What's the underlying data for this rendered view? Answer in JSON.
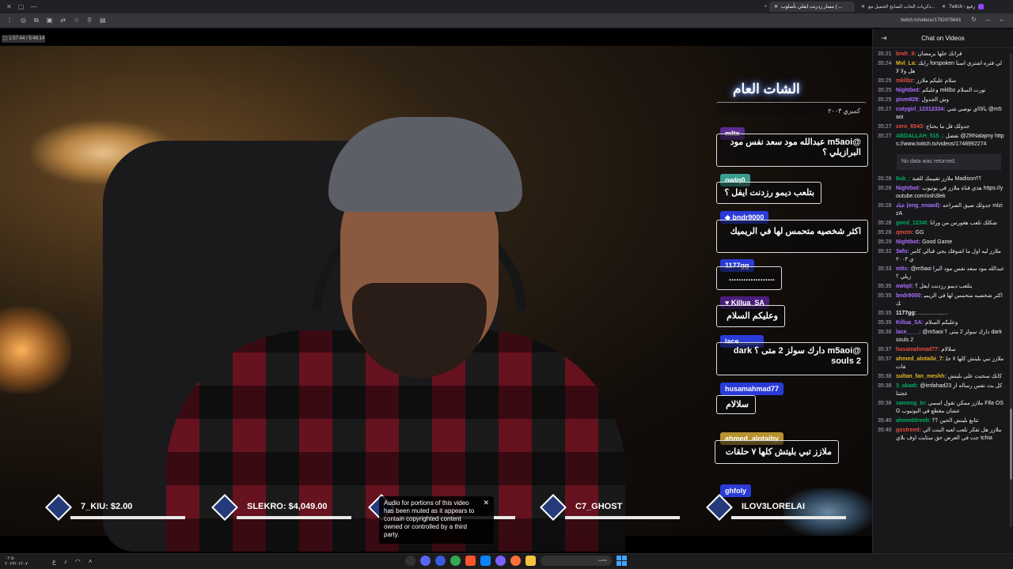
{
  "browser": {
    "tabs": [
      {
        "label": "Twitch - رفيع",
        "active": false
      },
      {
        "label": "ذكريات الحاب السابح الجميل مع..."
      },
      {
        "label": "مسار ردزنت ايفلي بأسلوب ( ... ",
        "active": true
      }
    ],
    "new_tab": "+",
    "url": "twitch.tv/videos/1792475643"
  },
  "video": {
    "tag": "▢ 1:57:44 / 5:46:14",
    "overlay_title": "الشات العام",
    "overlay_messages": [
      {
        "name": "",
        "text": "كمبري ٢٠٠٣",
        "name_color": "#000000"
      },
      {
        "name": "mltx",
        "text": "@m5aoi عبدالله مود سعد نفس مود البرازيلي ؟",
        "name_color": "#5b2d91"
      },
      {
        "name": "owlq0",
        "text": "بتلعب ديمو رزدنت ايفل ؟",
        "name_color": "#3a9e8f"
      },
      {
        "name": "bndr9000",
        "text": "اكثر شخصيه متحمس لها في الريميك",
        "name_color": "#2a3bd8"
      },
      {
        "name": "1177gg",
        "text": "...................",
        "name_color": "#2a3bd8"
      },
      {
        "name": "Killua_SA",
        "text": "وعليكم السلام",
        "name_color": "#4a1e7a"
      },
      {
        "name": "lace_____",
        "text": "@m5aoi دارك سولز 2 متى ؟ dark souls 2",
        "name_color": "#2a3bd8"
      },
      {
        "name": "husamahmad77",
        "text": "سلالام",
        "name_color": "#2a3bd8"
      },
      {
        "name": "ahmed_alotaiby",
        "text": "ملازز تبي بليتش كلها ٧ حلقات",
        "name_color": "#b8922f"
      },
      {
        "name": "ghfoly",
        "text": "",
        "name_color": "#2a3bd8"
      }
    ],
    "scores": [
      {
        "label": "7_KIU: $2.00"
      },
      {
        "label": "SLEKRO: $4,049.00"
      },
      {
        "label": ""
      },
      {
        "label": "C7_GHOST"
      },
      {
        "label": "ILOV3LORELAI"
      }
    ],
    "notice": "Audio for portions of this video has been muted as it appears to contain copyrighted content owned or controlled by a third party.",
    "notice_close": "✕"
  },
  "chat": {
    "header": "Chat on Videos",
    "nodata": "No data was returned.",
    "messages": [
      {
        "time": "35:21",
        "user": "bndr_9:",
        "color": "#e84c3d",
        "text": "قرانك خلها برمضان"
      },
      {
        "time": "35:24",
        "user": "Mvl_La:",
        "color": "#e6b422",
        "text": "رايك forspoken لي فتره اشتري استاهل ولا لا"
      },
      {
        "time": "35:25",
        "user": "mklibz:",
        "color": "#e84c3d",
        "text": "سلام عليكم ملازز"
      },
      {
        "time": "35:25",
        "user": "Nightbot:",
        "color": "#a970ff",
        "text": "وعليكم mklibz نورت السلام"
      },
      {
        "time": "35:25",
        "user": "pism929:",
        "color": "#a970ff",
        "text": "وش الجدول"
      },
      {
        "time": "35:27",
        "user": "cutygirl_12312334:",
        "color": "#a970ff",
        "text": "بالاااي نوصي شي @m5aoi"
      },
      {
        "time": "35:27",
        "user": "zero_6543:",
        "color": "#e84c3d",
        "text": "جدولك فل ما يحتاج"
      },
      {
        "time": "35:27",
        "user": "ABDALLAH_515_:",
        "color": "#00ad5f",
        "text": "تفضل @ZRNalajmy https://www.twitch.tv/videos/1748992274"
      },
      {
        "time": "35:28",
        "user": "6ub_:",
        "color": "#00ad5f",
        "text": "ملازز تقييمك للعبة Madison؟؟"
      },
      {
        "time": "35:28",
        "user": "Nightbot:",
        "color": "#a970ff",
        "text": "هذي قناة ملازز في يوتيوب https://youtube.com/osh3lek"
      },
      {
        "time": "35:28",
        "user": "عناد (eng_enaad):",
        "color": "#a970ff",
        "text": "جدولك ضيق الصراحه mlzizA"
      },
      {
        "time": "35:28",
        "user": "good_1234t:",
        "color": "#00ad5f",
        "text": "شكلك تلعب هغورس من ورانا"
      },
      {
        "time": "35:28",
        "user": "qmzm:",
        "color": "#e84c3d",
        "text": "GG"
      },
      {
        "time": "35:29",
        "user": "Nightbot:",
        "color": "#a970ff",
        "text": "Good Game"
      },
      {
        "time": "35:32",
        "user": "3afo:",
        "color": "#a970ff",
        "text": "ملازز ليه اول ما اشوفك يجي قبالي كامري ٢٠٠٣"
      },
      {
        "time": "35:33",
        "user": "mltx:",
        "color": "#a970ff",
        "text": "@m5aoi عبدالله مود سعد نفس مود البرازيلي ؟"
      },
      {
        "time": "35:35",
        "user": "owlq0:",
        "color": "#a970ff",
        "text": "بتلعب ديمو رزدنت ايفل ؟"
      },
      {
        "time": "35:35",
        "user": "bndr9000:",
        "color": "#a970ff",
        "text": "اكثر شخصيه متحمس لها في الريميك"
      },
      {
        "time": "35:35",
        "user": "1177gg:",
        "color": "#efeff1",
        "text": "..................."
      },
      {
        "time": "35:35",
        "user": "Killua_SA:",
        "color": "#a970ff",
        "text": "وعليكم السلام"
      },
      {
        "time": "35:36",
        "user": "lace____:",
        "color": "#a970ff",
        "text": "@m5aoi دارك سولز 2 متى ؟ dark souls 2"
      },
      {
        "time": "35:37",
        "user": "husamahmad77:",
        "color": "#e84c3d",
        "text": "سلالام"
      },
      {
        "time": "35:37",
        "user": "ahmed_alotaibi_7:",
        "color": "#e6b422",
        "text": "ملازز تبي بليتش كلها ٧ حلقات"
      },
      {
        "time": "35:38",
        "user": "sultan_fan_meshh:",
        "color": "#e6b422",
        "text": "كانك سحبت على بليتش"
      },
      {
        "time": "35:38",
        "user": "3_abadi:",
        "color": "#00ad5f",
        "text": "@imfahad23 كل بث نفس رساله ازعجتنا"
      },
      {
        "time": "35:38",
        "user": "samosg_tv:",
        "color": "#00ad5f",
        "text": "ملازز ممكن تقول اسمي Fifa OSG عشان مقطع في اليوتيوب"
      },
      {
        "time": "35:40",
        "user": "ahmeddreeb:",
        "color": "#00ad5f",
        "text": "تتابع بليتش الحين ؟؟"
      },
      {
        "time": "35:40",
        "user": "gostreed:",
        "color": "#e84c3d",
        "text": "ملازز هل تفكر تلعب لعبه البنت الي جت في العرض حق ستايت اوف بلاي tchia"
      }
    ]
  },
  "taskbar": {
    "time": "٠٢:٥٠",
    "date": "٢٠٢٣/٠٢/٠٧",
    "search_placeholder": "بحث"
  }
}
